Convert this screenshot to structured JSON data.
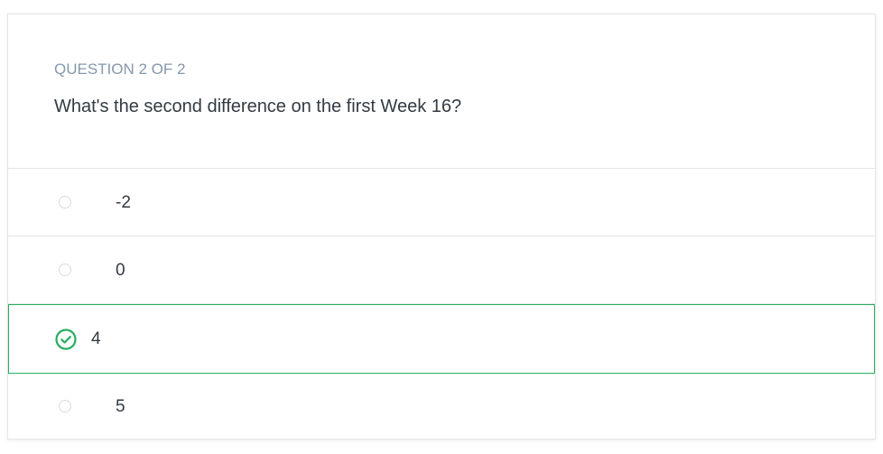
{
  "quiz": {
    "counter": "QUESTION 2 OF 2",
    "question": "What's the second difference on the first Week 16?",
    "options": [
      {
        "label": "-2",
        "state": "unselected"
      },
      {
        "label": "0",
        "state": "unselected"
      },
      {
        "label": "4",
        "state": "correct"
      },
      {
        "label": "5",
        "state": "unselected"
      }
    ]
  },
  "colors": {
    "correct": "#27ae60",
    "counter": "#8598ab",
    "text": "#333a42",
    "divider": "#e3e5e8"
  },
  "icons": {
    "correct_option": "check-circle-icon",
    "unselected_option": "radio-circle-icon"
  }
}
